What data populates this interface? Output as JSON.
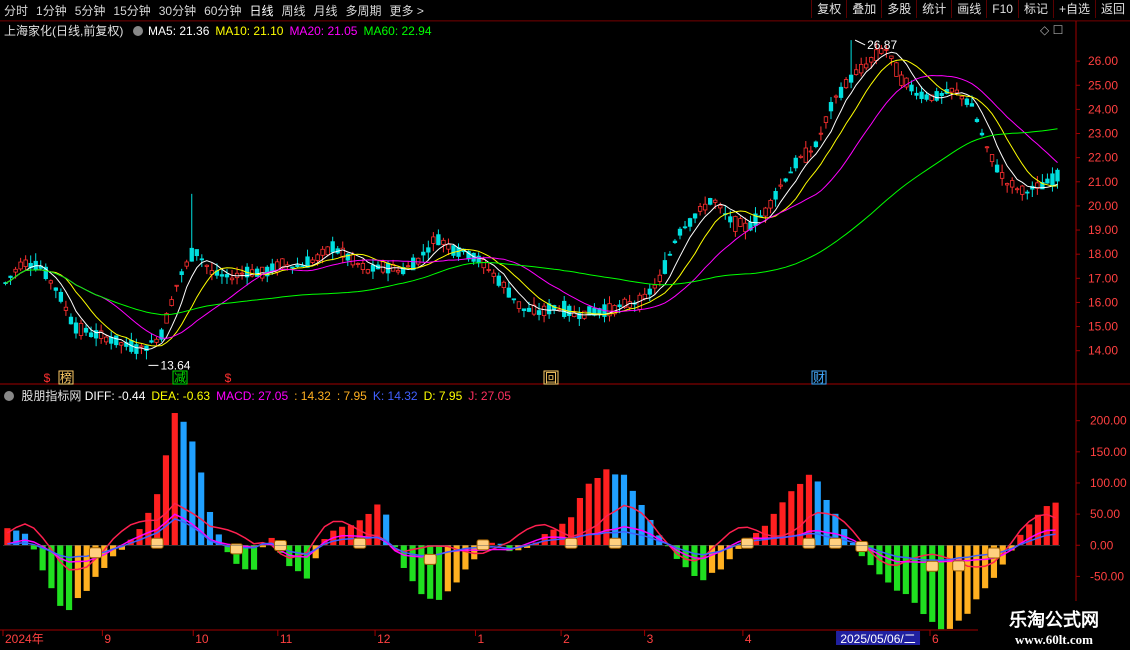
{
  "toolbar": {
    "periods": [
      {
        "label": "分时"
      },
      {
        "label": "1分钟"
      },
      {
        "label": "5分钟"
      },
      {
        "label": "15分钟"
      },
      {
        "label": "30分钟"
      },
      {
        "label": "60分钟"
      },
      {
        "label": "日线",
        "active": true
      },
      {
        "label": "周线"
      },
      {
        "label": "月线"
      },
      {
        "label": "多周期"
      },
      {
        "label": "更多 >"
      }
    ],
    "actions": [
      {
        "label": "复权"
      },
      {
        "label": "叠加"
      },
      {
        "label": "多股"
      },
      {
        "label": "统计"
      },
      {
        "label": "画线"
      },
      {
        "label": "F10"
      },
      {
        "label": "标记"
      },
      {
        "label": "+自选"
      },
      {
        "label": "返回"
      }
    ]
  },
  "main_panel": {
    "stock_title": "上海家化(日线,前复权)",
    "ma_legend": [
      {
        "text": "MA5: 21.36",
        "color": "#ffffff"
      },
      {
        "text": "MA10: 21.10",
        "color": "#ffff00"
      },
      {
        "text": "MA20: 21.05",
        "color": "#ff00ff"
      },
      {
        "text": "MA60: 22.94",
        "color": "#00ff00"
      }
    ],
    "high_label": "26.87",
    "low_label": "13.64",
    "markers": [
      {
        "text": "$",
        "color": "#ff3030"
      },
      {
        "text": "榜",
        "color": "#ffcc66"
      },
      {
        "text": "减",
        "color": "#00e000"
      },
      {
        "text": "$",
        "color": "#ff3030"
      },
      {
        "text": "回",
        "color": "#ffcc66"
      },
      {
        "text": "财",
        "color": "#44aaff"
      }
    ]
  },
  "indicator_panel": {
    "name": "股朋指标网",
    "legend": [
      {
        "text": "DIFF: -0.44",
        "color": "#ffffff"
      },
      {
        "text": "DEA: -0.63",
        "color": "#ffff00"
      },
      {
        "text": "MACD: 27.05",
        "color": "#ff00ff"
      },
      {
        "text": ": 14.32",
        "color": "#ffb020"
      },
      {
        "text": ": 7.95",
        "color": "#ffb020"
      },
      {
        "text": "K: 14.32",
        "color": "#4060ff"
      },
      {
        "text": "D: 7.95",
        "color": "#ffff00"
      },
      {
        "text": "J: 27.05",
        "color": "#ff3060"
      }
    ]
  },
  "top_right_icons": [
    "diamond-icon",
    "box-icon"
  ],
  "watermark": {
    "title": "乐淘公式网",
    "url": "www.60lt.com"
  },
  "chart_data": [
    {
      "type": "candlestick",
      "title": "上海家化(日线,前复权)",
      "ylim": [
        13.2,
        27.0
      ],
      "y_ticks": [
        14.0,
        15.0,
        16.0,
        17.0,
        18.0,
        19.0,
        20.0,
        21.0,
        22.0,
        23.0,
        24.0,
        25.0,
        26.0
      ],
      "x_ticks": [
        "2024年",
        "9",
        "10",
        "11",
        "12",
        "1",
        "2",
        "3",
        "4",
        "2025/05/06/二",
        "6"
      ],
      "close_path": [
        16.8,
        17.7,
        17.5,
        16.5,
        15.0,
        14.7,
        14.5,
        14.2,
        14.1,
        14.6,
        16.9,
        18.2,
        17.2,
        17.0,
        17.3,
        17.2,
        17.6,
        17.5,
        17.8,
        18.3,
        17.8,
        17.3,
        17.5,
        17.3,
        17.8,
        18.7,
        18.2,
        18.0,
        17.4,
        16.6,
        15.7,
        15.6,
        15.8,
        15.5,
        15.6,
        15.7,
        15.9,
        16.1,
        17.0,
        18.9,
        19.6,
        20.3,
        19.4,
        19.1,
        19.7,
        20.9,
        21.9,
        22.5,
        24.3,
        25.3,
        25.9,
        26.6,
        25.2,
        24.6,
        24.5,
        24.8,
        24.2,
        22.2,
        21.0,
        20.6,
        20.8,
        21.2
      ],
      "series": [
        {
          "name": "MA5",
          "color": "#ffffff"
        },
        {
          "name": "MA10",
          "color": "#ffff00"
        },
        {
          "name": "MA20",
          "color": "#ff00ff"
        },
        {
          "name": "MA60",
          "color": "#00ff00"
        }
      ]
    },
    {
      "type": "bar",
      "title": "股朋指标网",
      "ylim": [
        -120,
        230
      ],
      "y_ticks": [
        -100.0,
        -50.0,
        0.0,
        50.0,
        100.0,
        150.0,
        200.0
      ],
      "bar_values": [
        30,
        20,
        -45,
        -110,
        -80,
        -40,
        -10,
        20,
        80,
        220,
        160,
        30,
        -20,
        -50,
        20,
        -30,
        -55,
        15,
        30,
        40,
        70,
        -30,
        -75,
        -90,
        -60,
        -20,
        10,
        -10,
        -5,
        25,
        40,
        100,
        120,
        110,
        60,
        10,
        -30,
        -60,
        -40,
        -10,
        20,
        50,
        90,
        120,
        60,
        10,
        -30,
        -60,
        -80,
        -110,
        -140,
        -120,
        -80,
        -40,
        10,
        50,
        70
      ]
    }
  ]
}
